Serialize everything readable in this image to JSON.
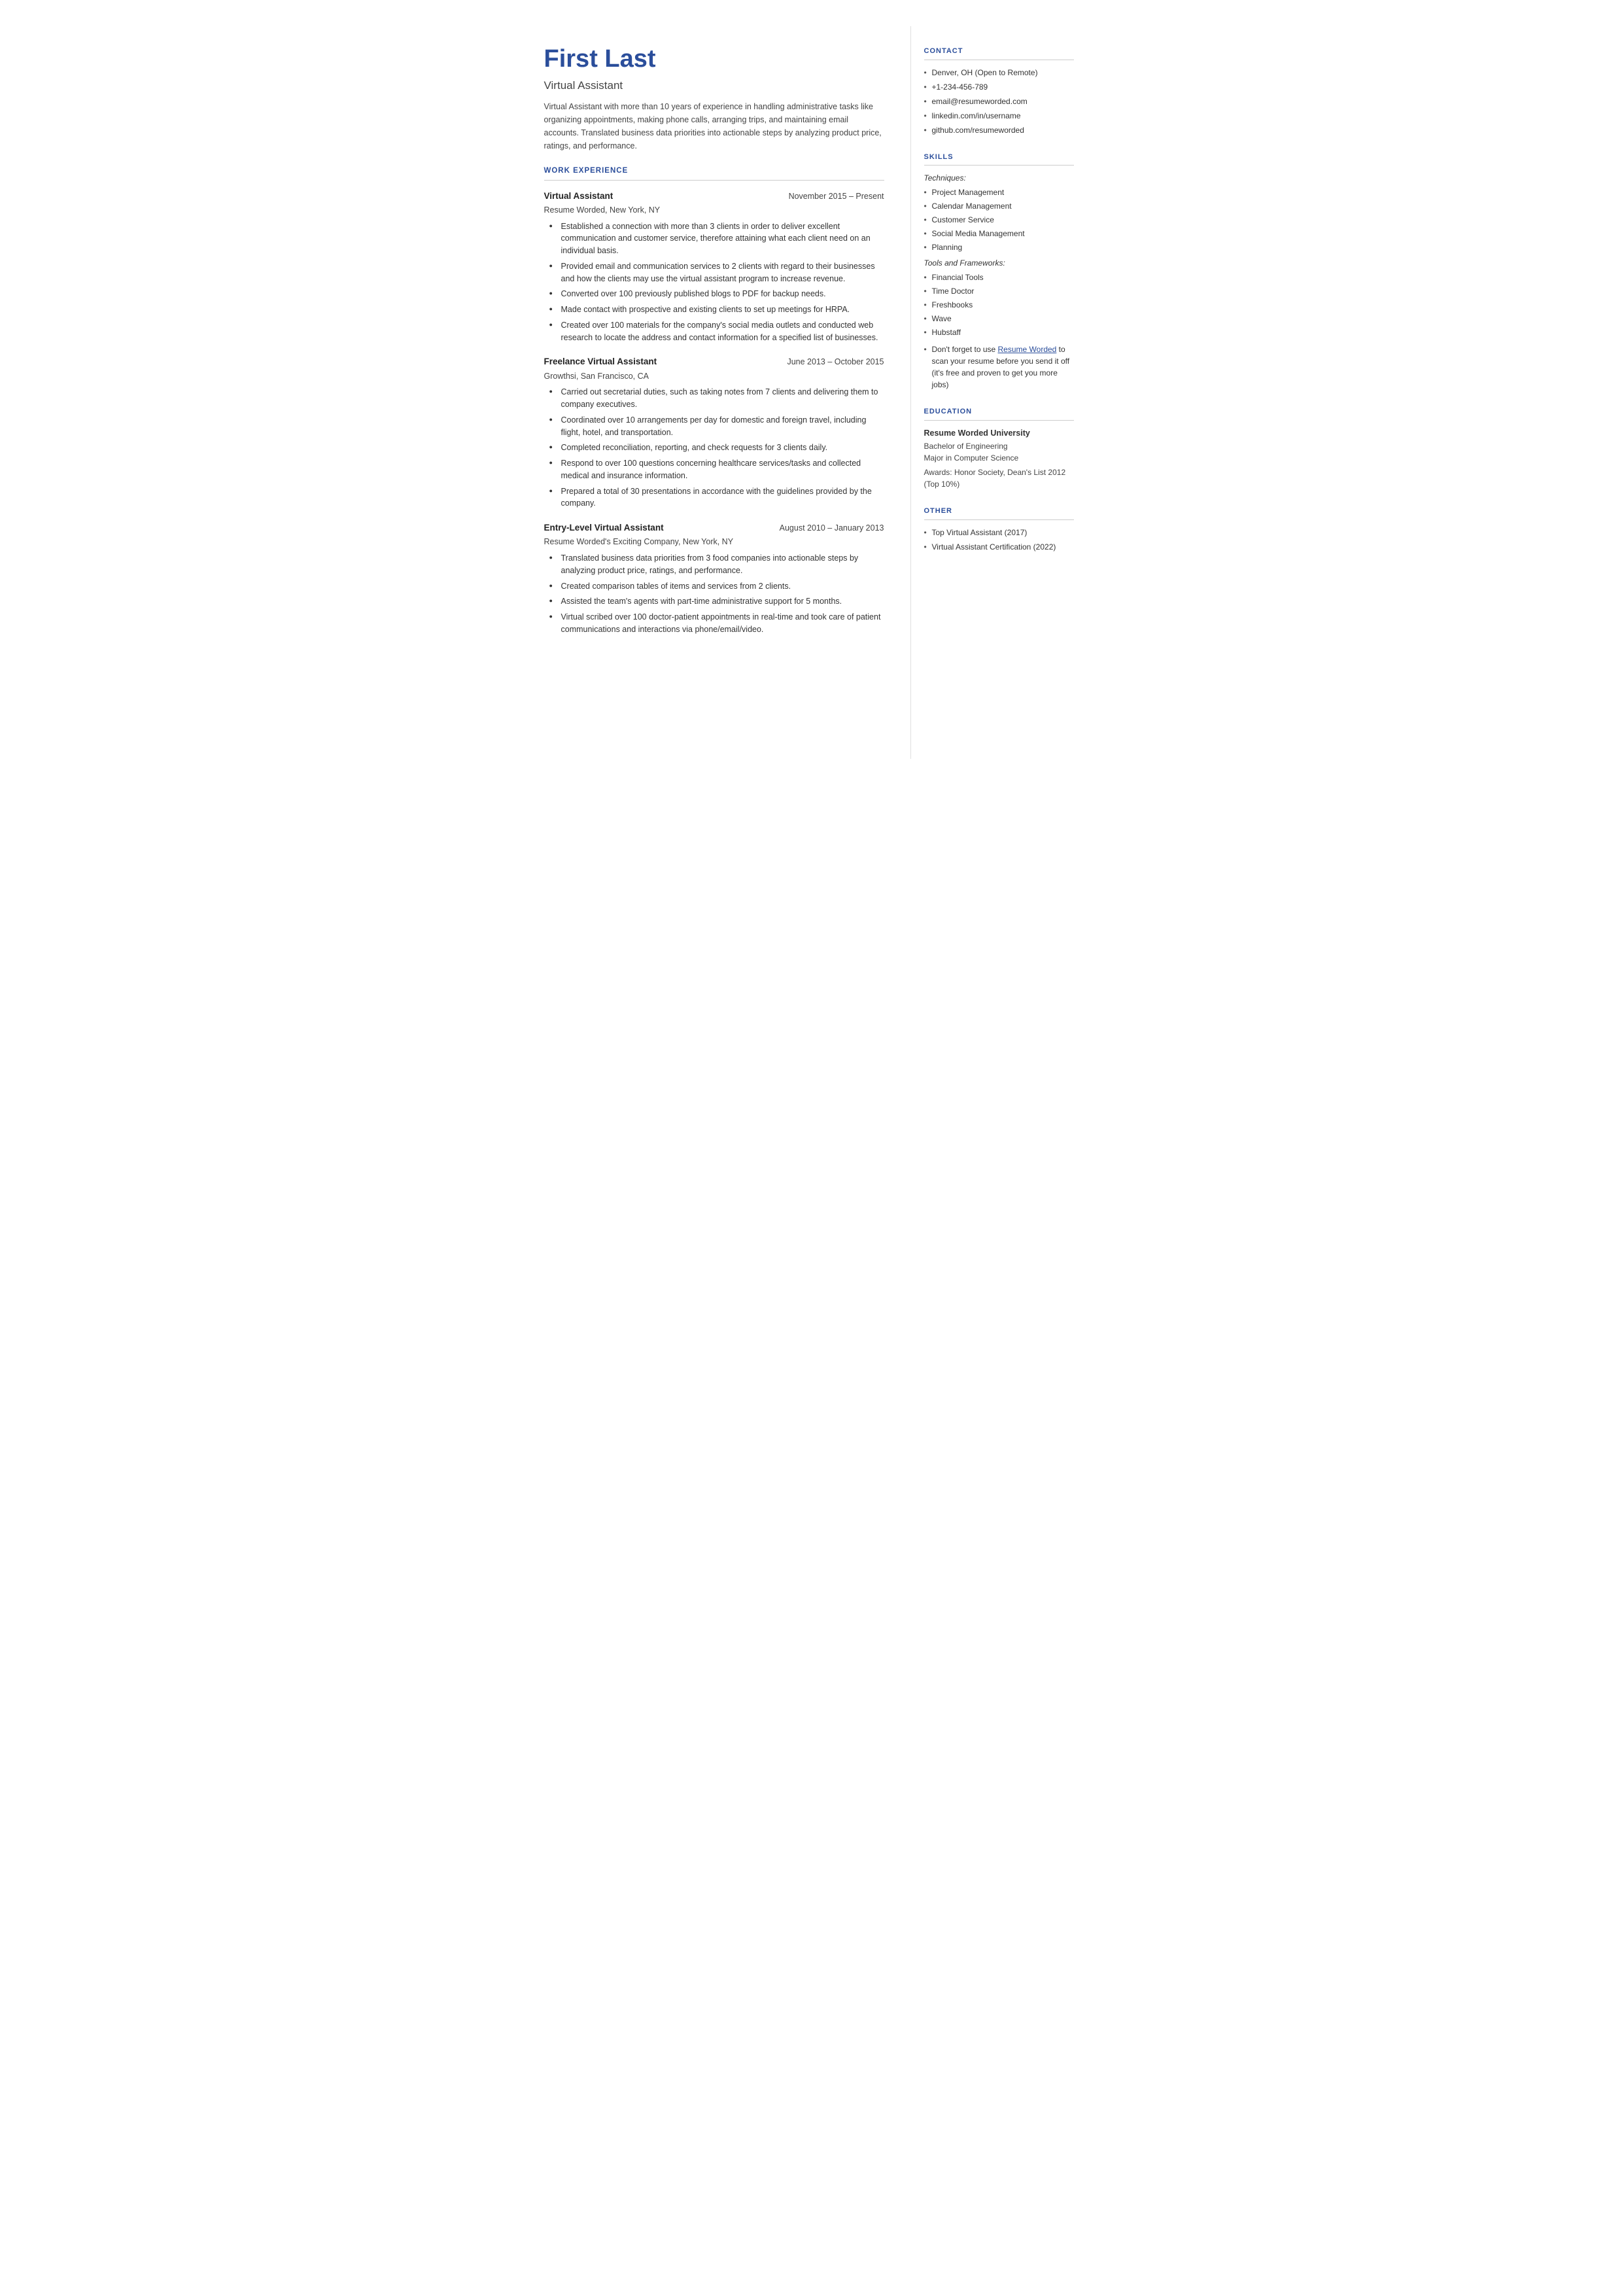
{
  "header": {
    "name": "First Last",
    "title": "Virtual Assistant",
    "summary": "Virtual Assistant with more than 10 years of experience in handling administrative tasks like organizing appointments, making phone calls, arranging trips, and maintaining email accounts. Translated business data priorities into actionable steps by analyzing product price, ratings, and performance."
  },
  "sections": {
    "work_experience_label": "WORK EXPERIENCE",
    "jobs": [
      {
        "title": "Virtual Assistant",
        "dates": "November 2015 – Present",
        "company": "Resume Worded, New York, NY",
        "bullets": [
          "Established a connection with more than 3 clients in order to deliver excellent communication and customer service, therefore attaining what each client need on an individual basis.",
          "Provided email and communication services to 2 clients with regard to their businesses and how the clients may use the virtual assistant program to increase revenue.",
          "Converted over 100 previously published blogs to PDF for backup needs.",
          "Made contact with prospective and existing clients to set up meetings for HRPA.",
          "Created over 100 materials for the company's social media outlets and conducted web research to locate the address and contact information for a specified list of businesses."
        ]
      },
      {
        "title": "Freelance Virtual Assistant",
        "dates": "June 2013 – October 2015",
        "company": "Growthsi, San Francisco, CA",
        "bullets": [
          "Carried out secretarial duties, such as taking notes from 7 clients and delivering them to company executives.",
          "Coordinated over 10 arrangements per day for domestic and foreign travel, including flight, hotel, and transportation.",
          "Completed reconciliation, reporting, and check requests for 3 clients daily.",
          "Respond to over 100 questions concerning healthcare services/tasks and collected medical and insurance information.",
          "Prepared a total of 30 presentations in accordance with the guidelines provided by the company."
        ]
      },
      {
        "title": "Entry-Level Virtual Assistant",
        "dates": "August 2010 – January 2013",
        "company": "Resume Worded's Exciting Company, New York, NY",
        "bullets": [
          "Translated business data priorities from 3 food companies into actionable steps by analyzing product price, ratings, and performance.",
          "Created comparison tables of items and services from 2 clients.",
          "Assisted the team's agents with part-time administrative support for 5 months.",
          "Virtual scribed over 100 doctor-patient appointments in real-time and took care of patient communications and interactions via phone/email/video."
        ]
      }
    ]
  },
  "sidebar": {
    "contact_label": "CONTACT",
    "contact_items": [
      "Denver, OH (Open to Remote)",
      "+1-234-456-789",
      "email@resumeworded.com",
      "linkedin.com/in/username",
      "github.com/resumeworded"
    ],
    "skills_label": "SKILLS",
    "techniques_label": "Techniques:",
    "techniques": [
      "Project Management",
      "Calendar Management",
      "Customer Service",
      "Social Media Management",
      "Planning"
    ],
    "tools_label": "Tools and Frameworks:",
    "tools": [
      "Financial Tools",
      "Time Doctor",
      "Freshbooks",
      "Wave",
      "Hubstaff"
    ],
    "promo_text": "Don't forget to use ",
    "promo_link_text": "Resume Worded",
    "promo_link_href": "#",
    "promo_suffix": " to scan your resume before you send it off (it's free and proven to get you more jobs)",
    "education_label": "EDUCATION",
    "education": {
      "school": "Resume Worded University",
      "degree": "Bachelor of Engineering",
      "major": "Major in Computer Science",
      "awards": "Awards: Honor Society, Dean's List 2012 (Top 10%)"
    },
    "other_label": "OTHER",
    "other_items": [
      "Top Virtual Assistant (2017)",
      "Virtual Assistant Certification (2022)"
    ]
  }
}
